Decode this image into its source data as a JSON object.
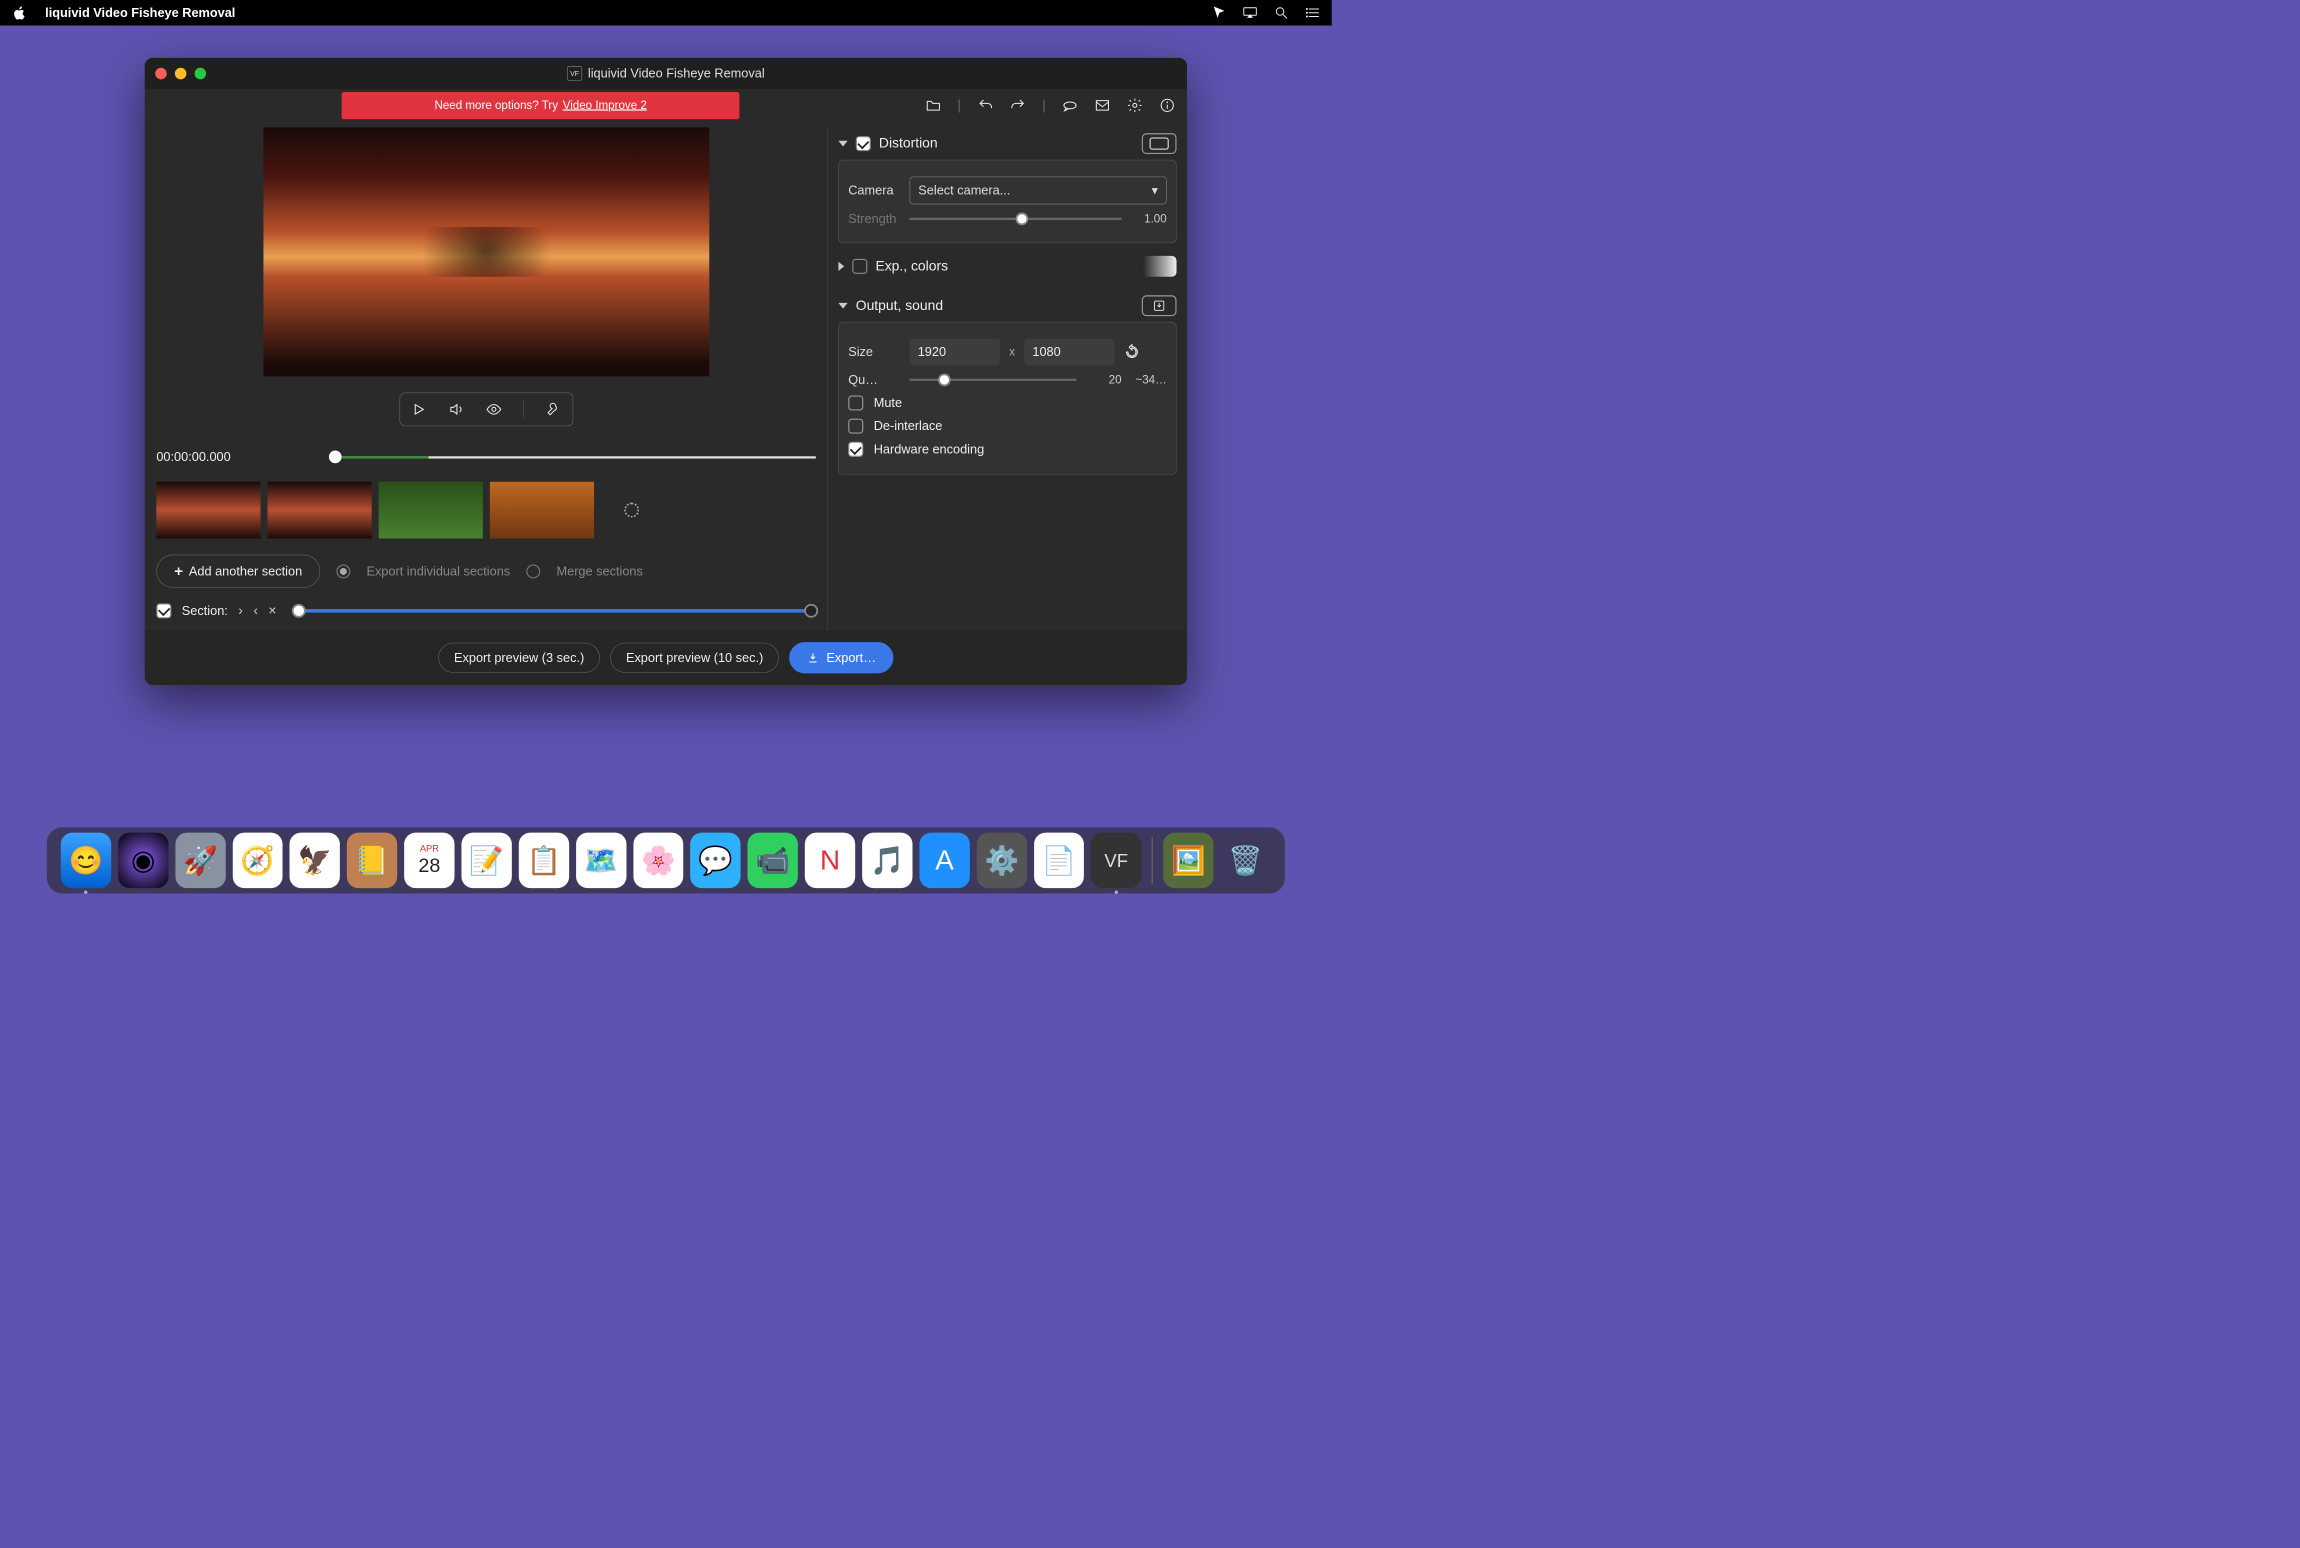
{
  "menubar": {
    "appName": "liquivid Video Fisheye Removal"
  },
  "window": {
    "title": "liquivid Video Fisheye Removal",
    "iconLabel": "VF",
    "banner": {
      "text": "Need more options? Try",
      "link": "Video Improve 2"
    }
  },
  "preview": {
    "timecode": "00:00:00.000",
    "controls": {}
  },
  "sectionBar": {
    "addButton": "Add another section",
    "exportIndividual": "Export individual sections",
    "merge": "Merge sections",
    "sectionLabel": "Section:"
  },
  "panels": {
    "distortion": {
      "title": "Distortion",
      "checked": true,
      "cameraLabel": "Camera",
      "cameraPlaceholder": "Select camera...",
      "strengthLabel": "Strength",
      "strengthValue": "1.00"
    },
    "expColors": {
      "title": "Exp., colors",
      "checked": false
    },
    "output": {
      "title": "Output, sound",
      "sizeLabel": "Size",
      "width": "1920",
      "height": "1080",
      "x": "x",
      "qualityLabel": "Qu…",
      "qualityValue": "20",
      "qualityEst": "~34…",
      "muteLabel": "Mute",
      "deinterlaceLabel": "De-interlace",
      "hwLabel": "Hardware encoding",
      "muteChecked": false,
      "deinterlaceChecked": false,
      "hwChecked": true
    }
  },
  "footer": {
    "preview3": "Export preview (3 sec.)",
    "preview10": "Export preview (10 sec.)",
    "export": "Export…"
  },
  "dock": {
    "apps": [
      "finder",
      "siri",
      "launchpad",
      "safari",
      "mail",
      "contacts",
      "calendar",
      "notes",
      "reminders",
      "maps",
      "photos",
      "messages",
      "facetime",
      "news",
      "music",
      "appstore",
      "preferences",
      "textedit",
      "vf"
    ]
  }
}
